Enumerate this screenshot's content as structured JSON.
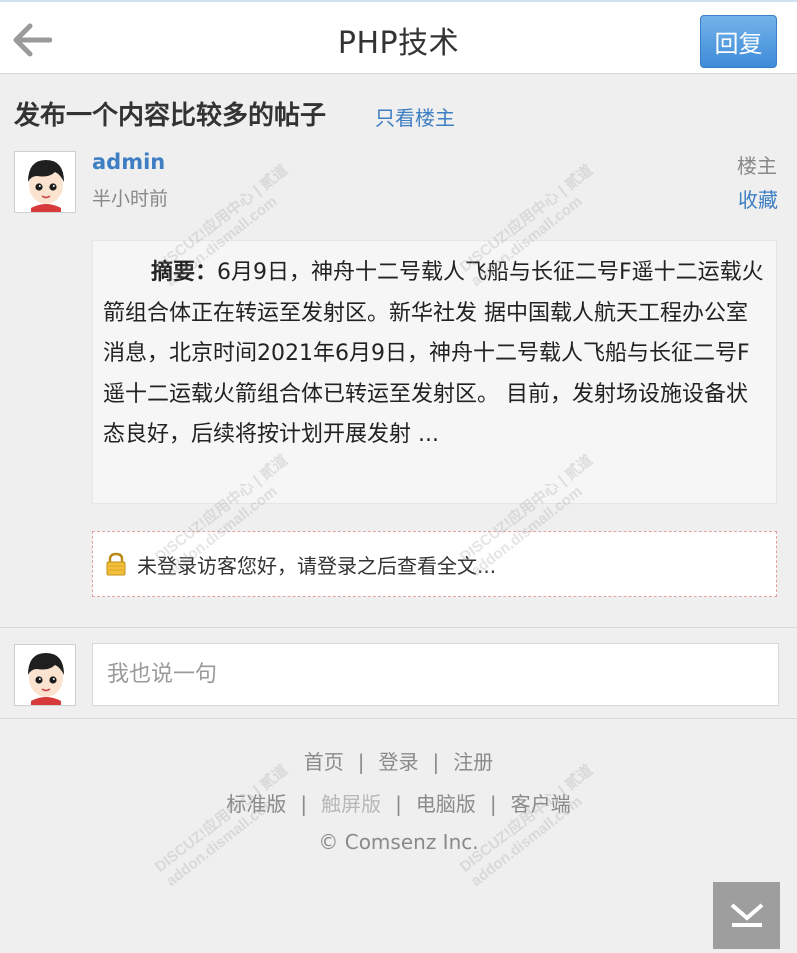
{
  "header": {
    "title": "PHP技术",
    "reply_label": "回复"
  },
  "thread": {
    "title": "发布一个内容比较多的帖子",
    "only_op_label": "只看楼主"
  },
  "post": {
    "author": "admin",
    "time": "半小时前",
    "floor": "楼主",
    "favorite_label": "收藏",
    "summary_label": "摘要：",
    "content": "6月9日，神舟十二号载人飞船与长征二号F遥十二运载火箭组合体正在转运至发射区。新华社发 据中国载人航天工程办公室消息，北京时间2021年6月9日，神舟十二号载人飞船与长征二号F遥十二运载火箭组合体已转运至发射区。 目前，发射场设施设备状态良好，后续将按计划开展发射 ..."
  },
  "login_notice": "未登录访客您好，请登录之后查看全文...",
  "reply_box": {
    "placeholder": "我也说一句"
  },
  "footer": {
    "row1": [
      "首页",
      "登录",
      "注册"
    ],
    "row2": [
      "标准版",
      "触屏版",
      "电脑版",
      "客户端"
    ],
    "copyright": "© Comsenz Inc."
  },
  "watermark_text": "DISCUZ!应用中心 | 贰道",
  "watermark_url": "addon.dismall.com",
  "colors": {
    "link": "#3e7fc3",
    "reply_button": "#4a96dc",
    "background": "#efefef"
  },
  "icons": {
    "back": "back-arrow-icon",
    "lock": "lock-icon",
    "scroll": "scroll-bottom-icon"
  }
}
